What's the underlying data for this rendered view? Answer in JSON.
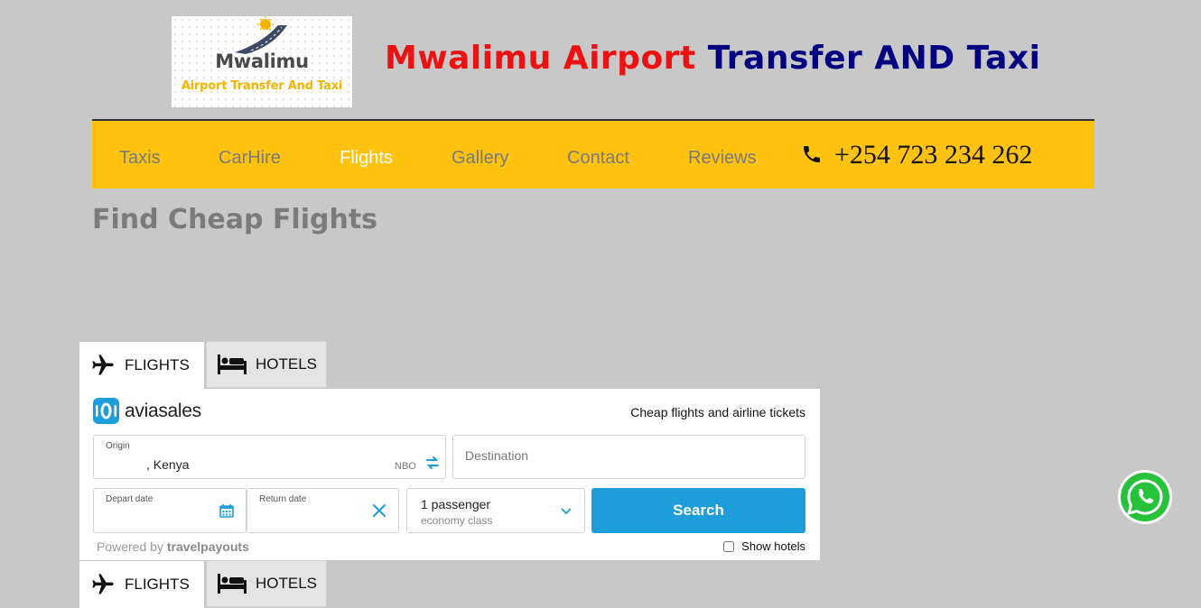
{
  "logo": {
    "name": "Mwalimu",
    "subtitle": "Airport Transfer And  Taxi"
  },
  "title": {
    "part1": "Mwalimu Airport",
    "part2": "Transfer AND Taxi"
  },
  "colors": {
    "nav_bg": "#fec20f",
    "title_red": "#ee1111",
    "title_blue": "#000080",
    "search_button": "#1e9ddb",
    "page_bg": "#c8c8c8"
  },
  "nav": {
    "items": [
      {
        "label": "Taxis"
      },
      {
        "label": "CarHire"
      },
      {
        "label": "Flights",
        "active": true
      },
      {
        "label": "Gallery"
      },
      {
        "label": "Contact"
      },
      {
        "label": "Reviews"
      }
    ],
    "phone": "+254 723 234 262",
    "phone_icon": "phone-icon"
  },
  "page": {
    "heading": "Find Cheap Flights"
  },
  "widget": {
    "tabs": [
      {
        "label": "FLIGHTS",
        "icon": "plane-icon"
      },
      {
        "label": "HOTELS",
        "icon": "bed-icon"
      }
    ],
    "brand": "aviasales",
    "tagline": "Cheap flights and airline tickets",
    "origin": {
      "label": "Origin",
      "value": ", Kenya",
      "code": "NBO"
    },
    "destination": {
      "placeholder": "Destination"
    },
    "depart": {
      "label": "Depart date"
    },
    "return": {
      "label": "Return date"
    },
    "passengers": {
      "count": "1 passenger",
      "class": "economy class"
    },
    "search_label": "Search",
    "powered_prefix": "Powered by",
    "powered_brand": "travelpayouts",
    "show_hotels": "Show hotels"
  }
}
